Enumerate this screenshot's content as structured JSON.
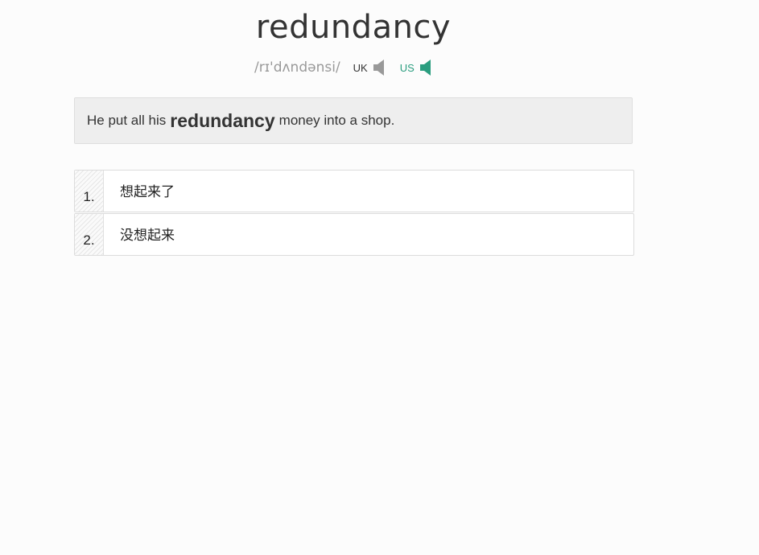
{
  "word": "redundancy",
  "phonetic": "/rɪ'dʌndənsi/",
  "pronunciation": {
    "uk_label": "UK",
    "us_label": "US",
    "uk_icon": "speaker-icon",
    "us_icon": "speaker-icon",
    "uk_color": "#999999",
    "us_color": "#2a9d7f"
  },
  "example": {
    "before": "He put all his",
    "highlight": "redundancy",
    "after": "money into a shop."
  },
  "choices": [
    {
      "number": "1.",
      "text": "想起来了"
    },
    {
      "number": "2.",
      "text": "没想起来"
    }
  ]
}
